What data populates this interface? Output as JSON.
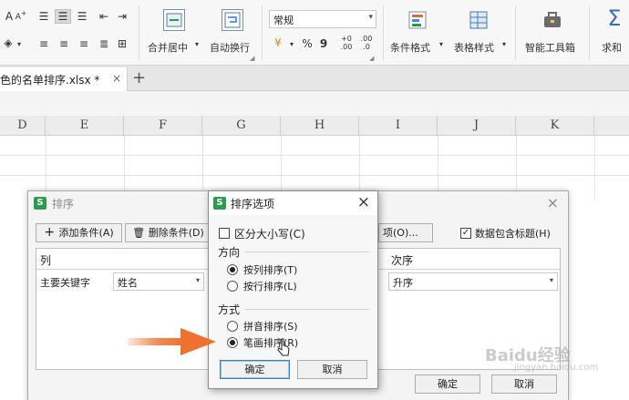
{
  "ribbon": {
    "merge_center": "合并居中",
    "auto_wrap": "自动换行",
    "number_format": "常规",
    "percent": "%",
    "comma": "9",
    "dec_inc": ".00\n+.0",
    "cond_format": "条件格式",
    "table_style": "表格样式",
    "smart_toolbox": "智能工具箱",
    "sum": "求和"
  },
  "tabs": {
    "file_name": "色的名单排序.xlsx *",
    "close": "×",
    "add": "+"
  },
  "columns": [
    "D",
    "E",
    "F",
    "G",
    "H",
    "I",
    "J",
    "K"
  ],
  "sort_dialog": {
    "title": "排序",
    "add_condition": "添加条件(A)",
    "delete_condition": "删除条件(D)",
    "options": "项(O)...",
    "has_header": "数据包含标题(H)",
    "col_header": "列",
    "order_header": "次序",
    "primary_key": "主要关键字",
    "key_value": "姓名",
    "order_value": "升序",
    "ok": "确定",
    "cancel": "取消",
    "close": "×"
  },
  "options_dialog": {
    "title": "排序选项",
    "case_sensitive": "区分大小写(C)",
    "direction_label": "方向",
    "by_column": "按列排序(T)",
    "by_row": "按行排序(L)",
    "method_label": "方式",
    "pinyin": "拼音排序(S)",
    "stroke": "笔画排序(R)",
    "ok": "确定",
    "cancel": "取消",
    "close": "×"
  },
  "watermark": {
    "main": "Baidu经验",
    "sub": "jingyan.baidu.com"
  },
  "colors": {
    "accent_arrow": "#ee7130",
    "logo_green": "#2e9a4d",
    "ok_border": "#3c7fb1"
  }
}
